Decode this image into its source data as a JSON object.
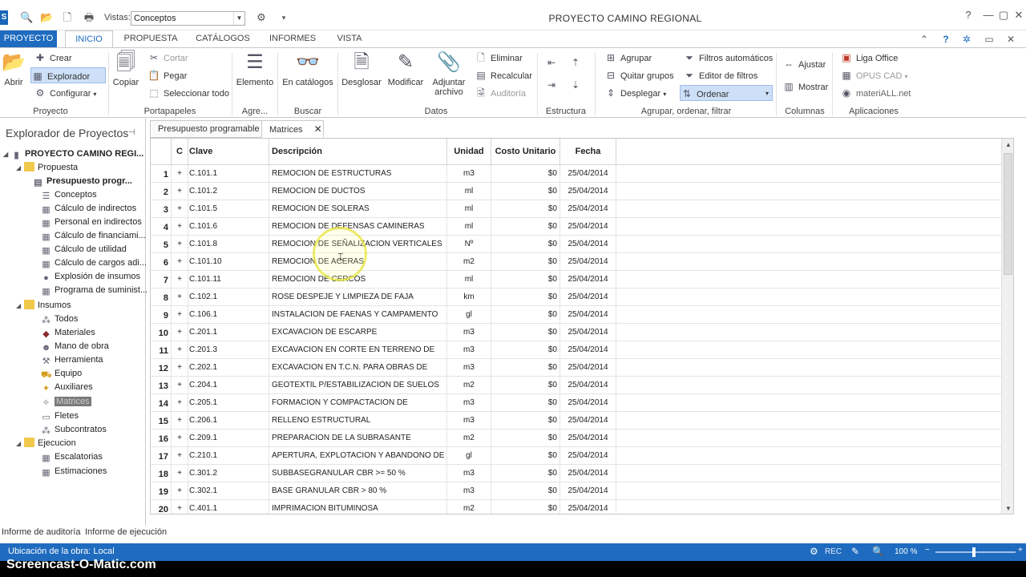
{
  "titlebar": {
    "app_icon_letter": "S",
    "vistas_label": "Vistas:",
    "vistas_value": "Conceptos",
    "window_title": "PROYECTO CAMINO REGIONAL"
  },
  "tabs": {
    "file": "PROYECTO",
    "items": [
      "INICIO",
      "PROPUESTA",
      "CATÁLOGOS",
      "INFORMES",
      "VISTA"
    ]
  },
  "ribbon": {
    "groups": {
      "proyecto": "Proyecto",
      "portapapeles": "Portapapeles",
      "agregar": "Agre...",
      "buscar": "Buscar",
      "datos": "Datos",
      "estructura": "Estructura",
      "agrupar": "Agrupar, ordenar, filtrar",
      "columnas": "Columnas",
      "aplicaciones": "Aplicaciones"
    },
    "abrir": "Abrir",
    "crear": "Crear",
    "explorador": "Explorador",
    "configurar": "Configurar",
    "copiar": "Copiar",
    "cortar": "Cortar",
    "pegar": "Pegar",
    "seleccionar_todo": "Seleccionar todo",
    "elemento": "Elemento",
    "en_catalogos": "En catálogos",
    "desglosar": "Desglosar",
    "modificar": "Modificar",
    "adjuntar_archivo_l1": "Adjuntar",
    "adjuntar_archivo_l2": "archivo",
    "eliminar": "Eliminar",
    "recalcular": "Recalcular",
    "auditoria": "Auditoría",
    "agrupar_btn": "Agrupar",
    "quitar_grupos": "Quitar grupos",
    "desplegar": "Desplegar",
    "filtros_automaticos": "Filtros automáticos",
    "editor_de_filtros": "Editor de filtros",
    "ordenar": "Ordenar",
    "ajustar": "Ajustar",
    "mostrar": "Mostrar",
    "liga_office": "Liga Office",
    "opus_cad": "OPUS CAD",
    "materiall": "materiALL.net"
  },
  "explorer": {
    "title": "Explorador de Proyectos",
    "root": "PROYECTO CAMINO REGI...",
    "propuesta": "Propuesta",
    "presupuesto": "Presupuesto progr...",
    "conceptos": "Conceptos",
    "calculo_indirectos": "Cálculo de indirectos",
    "personal_indirectos": "Personal en indirectos",
    "calculo_financiamiento": "Cálculo de financiami...",
    "calculo_utilidad": "Cálculo de utilidad",
    "calculo_cargos": "Cálculo de cargos adi...",
    "explosion_insumos": "Explosión de insumos",
    "programa_suministros": "Programa de suminist...",
    "insumos": "Insumos",
    "todos": "Todos",
    "materiales": "Materiales",
    "mano_obra": "Mano de obra",
    "herramienta": "Herramienta",
    "equipo": "Equipo",
    "auxiliares": "Auxiliares",
    "matrices": "Matrices",
    "fletes": "Fletes",
    "subcontratos": "Subcontratos",
    "ejecucion": "Ejecucion",
    "escalatorias": "Escalatorias",
    "estimaciones": "Estimaciones"
  },
  "doc_tabs": {
    "tab1": "Presupuesto programable",
    "tab2": "Matrices"
  },
  "grid": {
    "headers": {
      "c": "C",
      "clave": "Clave",
      "descripcion": "Descripción",
      "unidad": "Unidad",
      "costo": "Costo Unitario",
      "fecha": "Fecha"
    },
    "rows": [
      {
        "n": "1",
        "clave": "C.101.1",
        "desc": "REMOCION DE ESTRUCTURAS",
        "unidad": "m3",
        "costo": "$0",
        "fecha": "25/04/2014"
      },
      {
        "n": "2",
        "clave": "C.101.2",
        "desc": "REMOCION DE DUCTOS",
        "unidad": "ml",
        "costo": "$0",
        "fecha": "25/04/2014"
      },
      {
        "n": "3",
        "clave": "C.101.5",
        "desc": "REMOCION DE SOLERAS",
        "unidad": "ml",
        "costo": "$0",
        "fecha": "25/04/2014"
      },
      {
        "n": "4",
        "clave": "C.101.6",
        "desc": "REMOCION DE DEFENSAS CAMINERAS",
        "unidad": "ml",
        "costo": "$0",
        "fecha": "25/04/2014"
      },
      {
        "n": "5",
        "clave": "C.101.8",
        "desc": "REMOCION DE SEÑALIZACION VERTICALES",
        "unidad": "Nº",
        "costo": "$0",
        "fecha": "25/04/2014"
      },
      {
        "n": "6",
        "clave": "C.101.10",
        "desc": "REMOCION DE ACERAS",
        "unidad": "m2",
        "costo": "$0",
        "fecha": "25/04/2014"
      },
      {
        "n": "7",
        "clave": "C.101.11",
        "desc": "REMOCION DE CERCOS",
        "unidad": "ml",
        "costo": "$0",
        "fecha": "25/04/2014"
      },
      {
        "n": "8",
        "clave": "C.102.1",
        "desc": "ROSE DESPEJE Y LIMPIEZA DE FAJA",
        "unidad": "km",
        "costo": "$0",
        "fecha": "25/04/2014"
      },
      {
        "n": "9",
        "clave": "C.106.1",
        "desc": "INSTALACION DE FAENAS Y CAMPAMENTO",
        "unidad": "gl",
        "costo": "$0",
        "fecha": "25/04/2014"
      },
      {
        "n": "10",
        "clave": "C.201.1",
        "desc": "EXCAVACION DE ESCARPE",
        "unidad": "m3",
        "costo": "$0",
        "fecha": "25/04/2014"
      },
      {
        "n": "11",
        "clave": "C.201.3",
        "desc": "EXCAVACION EN CORTE EN TERRENO DE",
        "unidad": "m3",
        "costo": "$0",
        "fecha": "25/04/2014"
      },
      {
        "n": "12",
        "clave": "C.202.1",
        "desc": "EXCAVACION EN T.C.N.  PARA OBRAS DE",
        "unidad": "m3",
        "costo": "$0",
        "fecha": "25/04/2014"
      },
      {
        "n": "13",
        "clave": "C.204.1",
        "desc": "GEOTEXTIL P/ESTABILIZACION DE SUELOS",
        "unidad": "m2",
        "costo": "$0",
        "fecha": "25/04/2014"
      },
      {
        "n": "14",
        "clave": "C.205.1",
        "desc": "FORMACION Y COMPACTACION DE",
        "unidad": "m3",
        "costo": "$0",
        "fecha": "25/04/2014"
      },
      {
        "n": "15",
        "clave": "C.206.1",
        "desc": "RELLENO ESTRUCTURAL",
        "unidad": "m3",
        "costo": "$0",
        "fecha": "25/04/2014"
      },
      {
        "n": "16",
        "clave": "C.209.1",
        "desc": "PREPARACION DE LA SUBRASANTE",
        "unidad": "m2",
        "costo": "$0",
        "fecha": "25/04/2014"
      },
      {
        "n": "17",
        "clave": "C.210.1",
        "desc": "APERTURA, EXPLOTACION Y ABANDONO DE",
        "unidad": "gl",
        "costo": "$0",
        "fecha": "25/04/2014"
      },
      {
        "n": "18",
        "clave": "C.301.2",
        "desc": "SUBBASEGRANULAR CBR >= 50 %",
        "unidad": "m3",
        "costo": "$0",
        "fecha": "25/04/2014"
      },
      {
        "n": "19",
        "clave": "C.302.1",
        "desc": "BASE GRANULAR CBR > 80 %",
        "unidad": "m3",
        "costo": "$0",
        "fecha": "25/04/2014"
      },
      {
        "n": "20",
        "clave": "C.401.1",
        "desc": "IMPRIMACION BITUMINOSA",
        "unidad": "m2",
        "costo": "$0",
        "fecha": "25/04/2014"
      }
    ]
  },
  "bottom_tabs": {
    "auditoria": "Informe de auditoría",
    "ejecucion": "Informe de ejecución"
  },
  "status": {
    "location": "Ubicación de la obra: Local",
    "rec": "REC",
    "zoom": "100 %",
    "zoom_level_percent": 100
  },
  "watermark": "Screencast-O-Matic.com"
}
